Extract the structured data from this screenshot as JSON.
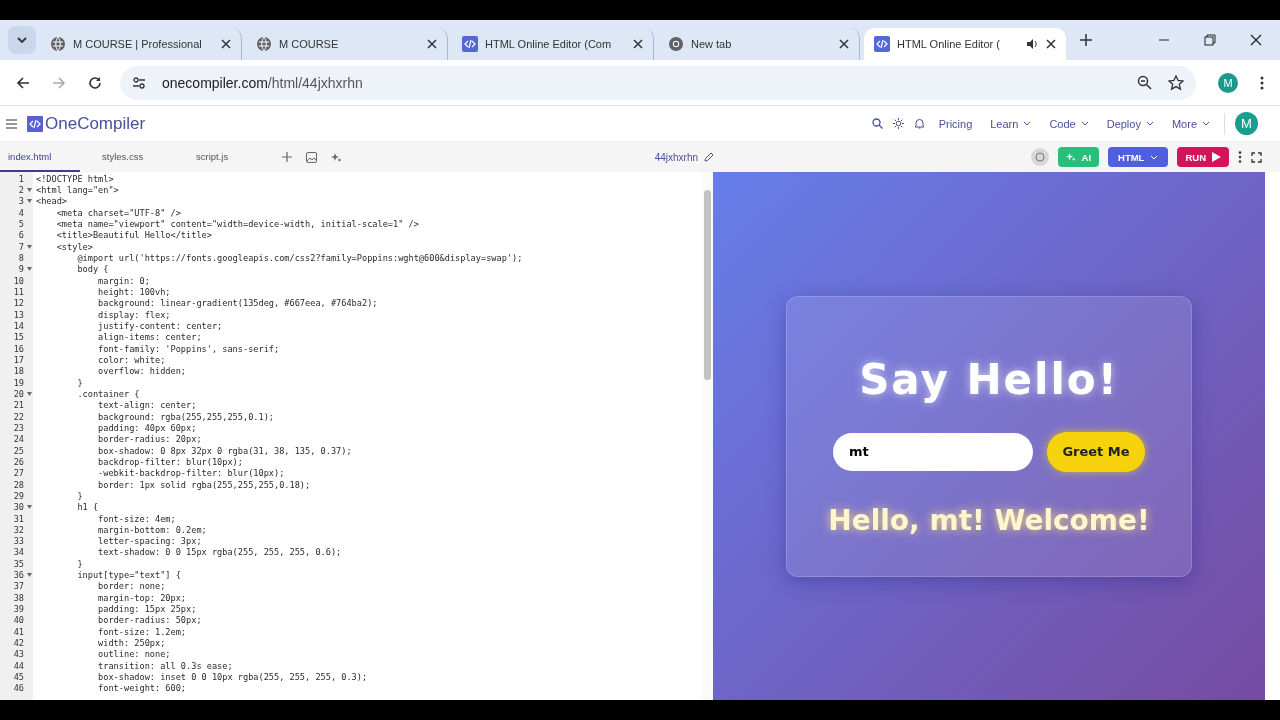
{
  "browser": {
    "tabs": [
      {
        "title": "M COURSE | Professional",
        "kind": "globe",
        "selected": false,
        "audio": false
      },
      {
        "title": "M COURSE",
        "kind": "globe",
        "selected": false,
        "audio": false
      },
      {
        "title": "HTML Online Editor (Com",
        "kind": "code",
        "selected": false,
        "audio": false
      },
      {
        "title": "New tab",
        "kind": "chrome",
        "selected": false,
        "audio": false
      },
      {
        "title": "HTML Online Editor (",
        "kind": "code",
        "selected": true,
        "audio": true
      }
    ],
    "url_host": "onecompiler.com",
    "url_path": "/html/44jxhxrhn",
    "profile": "M"
  },
  "site": {
    "logo": "OneCompiler",
    "nav": [
      {
        "label": "Pricing",
        "dropdown": false
      },
      {
        "label": "Learn",
        "dropdown": true
      },
      {
        "label": "Code",
        "dropdown": true
      },
      {
        "label": "Deploy",
        "dropdown": true
      },
      {
        "label": "More",
        "dropdown": true
      }
    ],
    "avatar": "M"
  },
  "editor": {
    "files": [
      {
        "name": "index.html",
        "selected": true
      },
      {
        "name": "styles.css",
        "selected": false
      },
      {
        "name": "script.js",
        "selected": false
      }
    ],
    "project": "44jxhxrhn",
    "ai_button": "AI",
    "language": "HTML",
    "run_button": "RUN",
    "lines": [
      {
        "n": "1",
        "fold": false,
        "text": "<!DOCTYPE html>"
      },
      {
        "n": "2",
        "fold": true,
        "text": "<html lang=\"en\">"
      },
      {
        "n": "3",
        "fold": true,
        "text": "<head>"
      },
      {
        "n": "4",
        "fold": false,
        "text": "    <meta charset=\"UTF-8\" />"
      },
      {
        "n": "5",
        "fold": false,
        "text": "    <meta name=\"viewport\" content=\"width=device-width, initial-scale=1\" />"
      },
      {
        "n": "6",
        "fold": false,
        "text": "    <title>Beautiful Hello</title>"
      },
      {
        "n": "7",
        "fold": true,
        "text": "    <style>"
      },
      {
        "n": "8",
        "fold": false,
        "text": "        @import url('https://fonts.googleapis.com/css2?family=Poppins:wght@600&display=swap');"
      },
      {
        "n": "9",
        "fold": true,
        "text": "        body {"
      },
      {
        "n": "10",
        "fold": false,
        "text": "            margin: 0;"
      },
      {
        "n": "11",
        "fold": false,
        "text": "            height: 100vh;"
      },
      {
        "n": "12",
        "fold": false,
        "text": "            background: linear-gradient(135deg, #667eea, #764ba2);"
      },
      {
        "n": "13",
        "fold": false,
        "text": "            display: flex;"
      },
      {
        "n": "14",
        "fold": false,
        "text": "            justify-content: center;"
      },
      {
        "n": "15",
        "fold": false,
        "text": "            align-items: center;"
      },
      {
        "n": "16",
        "fold": false,
        "text": "            font-family: 'Poppins', sans-serif;"
      },
      {
        "n": "17",
        "fold": false,
        "text": "            color: white;"
      },
      {
        "n": "18",
        "fold": false,
        "text": "            overflow: hidden;"
      },
      {
        "n": "19",
        "fold": false,
        "text": "        }"
      },
      {
        "n": "20",
        "fold": true,
        "text": "        .container {"
      },
      {
        "n": "21",
        "fold": false,
        "text": "            text-align: center;"
      },
      {
        "n": "22",
        "fold": false,
        "text": "            background: rgba(255,255,255,0.1);"
      },
      {
        "n": "23",
        "fold": false,
        "text": "            padding: 40px 60px;"
      },
      {
        "n": "24",
        "fold": false,
        "text": "            border-radius: 20px;"
      },
      {
        "n": "25",
        "fold": false,
        "text": "            box-shadow: 0 8px 32px 0 rgba(31, 38, 135, 0.37);"
      },
      {
        "n": "26",
        "fold": false,
        "text": "            backdrop-filter: blur(10px);"
      },
      {
        "n": "27",
        "fold": false,
        "text": "            -webkit-backdrop-filter: blur(10px);"
      },
      {
        "n": "28",
        "fold": false,
        "text": "            border: 1px solid rgba(255,255,255,0.18);"
      },
      {
        "n": "29",
        "fold": false,
        "text": "        }"
      },
      {
        "n": "30",
        "fold": true,
        "text": "        h1 {"
      },
      {
        "n": "31",
        "fold": false,
        "text": "            font-size: 4em;"
      },
      {
        "n": "32",
        "fold": false,
        "text": "            margin-bottom: 0.2em;"
      },
      {
        "n": "33",
        "fold": false,
        "text": "            letter-spacing: 3px;"
      },
      {
        "n": "34",
        "fold": false,
        "text": "            text-shadow: 0 0 15px rgba(255, 255, 255, 0.6);"
      },
      {
        "n": "35",
        "fold": false,
        "text": "        }"
      },
      {
        "n": "36",
        "fold": true,
        "text": "        input[type=\"text\"] {"
      },
      {
        "n": "37",
        "fold": false,
        "text": "            border: none;"
      },
      {
        "n": "38",
        "fold": false,
        "text": "            margin-top: 20px;"
      },
      {
        "n": "39",
        "fold": false,
        "text": "            padding: 15px 25px;"
      },
      {
        "n": "40",
        "fold": false,
        "text": "            border-radius: 50px;"
      },
      {
        "n": "41",
        "fold": false,
        "text": "            font-size: 1.2em;"
      },
      {
        "n": "42",
        "fold": false,
        "text": "            width: 250px;"
      },
      {
        "n": "43",
        "fold": false,
        "text": "            outline: none;"
      },
      {
        "n": "44",
        "fold": false,
        "text": "            transition: all 0.3s ease;"
      },
      {
        "n": "45",
        "fold": false,
        "text": "            box-shadow: inset 0 0 10px rgba(255, 255, 255, 0.3);"
      },
      {
        "n": "46",
        "fold": false,
        "text": "            font-weight: 600;"
      }
    ]
  },
  "preview": {
    "heading": "Say Hello!",
    "input_value": "mt",
    "button": "Greet Me",
    "greeting": "Hello, mt! Welcome!"
  }
}
